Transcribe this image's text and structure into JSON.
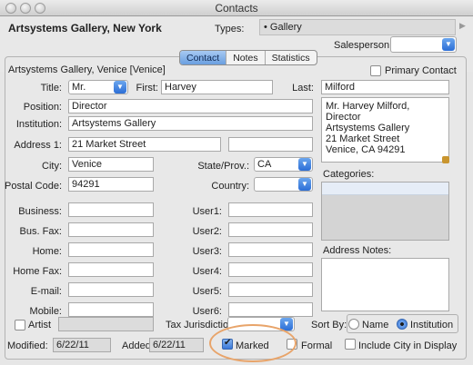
{
  "window": {
    "title": "Contacts"
  },
  "header": {
    "company": "Artsystems Gallery, New York",
    "types_label": "Types:",
    "types_value": "• Gallery",
    "salesperson_label": "Salesperson:"
  },
  "tabs": [
    "Contact",
    "Notes",
    "Statistics"
  ],
  "contact": {
    "display_name": "Artsystems Gallery, Venice [Venice]",
    "primary_contact_label": "Primary Contact",
    "title_label": "Title:",
    "title_value": "Mr.",
    "first_label": "First:",
    "first_value": "Harvey",
    "last_label": "Last:",
    "last_value": "Milford",
    "position_label": "Position:",
    "position_value": "Director",
    "institution_label": "Institution:",
    "institution_value": "Artsystems Gallery",
    "address1_label": "Address 1:",
    "address1_value": "21 Market Street",
    "city_label": "City:",
    "city_value": "Venice",
    "state_label": "State/Prov.:",
    "state_value": "CA",
    "postal_label": "Postal Code:",
    "postal_value": "94291",
    "country_label": "Country:",
    "address_block": [
      "Mr. Harvey Milford, Director",
      "Artsystems Gallery",
      "21 Market Street",
      "Venice, CA 94291"
    ],
    "categories_label": "Categories:",
    "address_notes_label": "Address Notes:"
  },
  "phones": {
    "left_labels": [
      "Business:",
      "Bus. Fax:",
      "Home:",
      "Home Fax:",
      "E-mail:",
      "Mobile:"
    ],
    "right_labels": [
      "User1:",
      "User2:",
      "User3:",
      "User4:",
      "User5:",
      "User6:"
    ]
  },
  "footer": {
    "artist_label": "Artist",
    "tax_label": "Tax Jurisdiction:",
    "sortby_label": "Sort By:",
    "sort_name": "Name",
    "sort_institution": "Institution",
    "modified_label": "Modified:",
    "modified_value": "6/22/11",
    "added_label": "Added:",
    "added_value": "6/22/11",
    "marked_label": "Marked",
    "formal_label": "Formal",
    "include_city_label": "Include City in Display"
  },
  "colors": {
    "tab_active": "#6a9fe0",
    "highlight": "#e8a46a",
    "select_button": "#2c6ed6"
  }
}
